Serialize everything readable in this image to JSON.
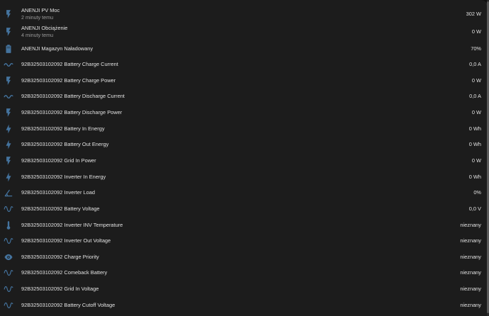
{
  "colors": {
    "icon": "#44739e",
    "text": "#e1e1e1",
    "secondary_text": "#9b9b9b",
    "card_background": "#1c1c1c"
  },
  "entities": [
    {
      "icon": "flash-icon",
      "name": "ANENJI PV Moc",
      "secondary": "2 minuty temu",
      "state": "302 W"
    },
    {
      "icon": "flash-icon",
      "name": "ANENJI Obciążenie",
      "secondary": "4 minuty temu",
      "state": "0 W"
    },
    {
      "icon": "battery-icon",
      "name": "ANENJI Magazyn Naładowany",
      "secondary": "",
      "state": "70%"
    },
    {
      "icon": "current-ac-icon",
      "name": "92B32503102092 Battery Charge Current",
      "secondary": "",
      "state": "0,0 A"
    },
    {
      "icon": "flash-icon",
      "name": "92B32503102092 Battery Charge Power",
      "secondary": "",
      "state": "0 W"
    },
    {
      "icon": "current-ac-icon",
      "name": "92B32503102092 Battery Discharge Current",
      "secondary": "",
      "state": "0,0 A"
    },
    {
      "icon": "flash-icon",
      "name": "92B32503102092 Battery Discharge Power",
      "secondary": "",
      "state": "0 W"
    },
    {
      "icon": "lightning-bolt-icon",
      "name": "92B32503102092 Battery In Energy",
      "secondary": "",
      "state": "0 Wh"
    },
    {
      "icon": "lightning-bolt-icon",
      "name": "92B32503102092 Battery Out Energy",
      "secondary": "",
      "state": "0 Wh"
    },
    {
      "icon": "flash-icon",
      "name": "92B32503102092 Grid In Power",
      "secondary": "",
      "state": "0 W"
    },
    {
      "icon": "lightning-bolt-icon",
      "name": "92B32503102092 Inverter In Energy",
      "secondary": "",
      "state": "0 Wh"
    },
    {
      "icon": "angle-acute-icon",
      "name": "92B32503102092 Inverter Load",
      "secondary": "",
      "state": "0%"
    },
    {
      "icon": "sine-wave-icon",
      "name": "92B32503102092 Battery Voltage",
      "secondary": "",
      "state": "0,0 V"
    },
    {
      "icon": "thermometer-icon",
      "name": "92B32503102092 Inverter INV Temperature",
      "secondary": "",
      "state": "nieznany"
    },
    {
      "icon": "sine-wave-icon",
      "name": "92B32503102092 Inverter Out Voltage",
      "secondary": "",
      "state": "nieznany"
    },
    {
      "icon": "eye-icon",
      "name": "92B32503102092 Charge Priority",
      "secondary": "",
      "state": "nieznany"
    },
    {
      "icon": "sine-wave-icon",
      "name": "92B32503102092 Comeback Battery",
      "secondary": "",
      "state": "nieznany"
    },
    {
      "icon": "sine-wave-icon",
      "name": "92B32503102092 Grid In Voltage",
      "secondary": "",
      "state": "nieznany"
    },
    {
      "icon": "sine-wave-icon",
      "name": "92B32503102092 Battery Cutoff Voltage",
      "secondary": "",
      "state": "nieznany"
    }
  ]
}
